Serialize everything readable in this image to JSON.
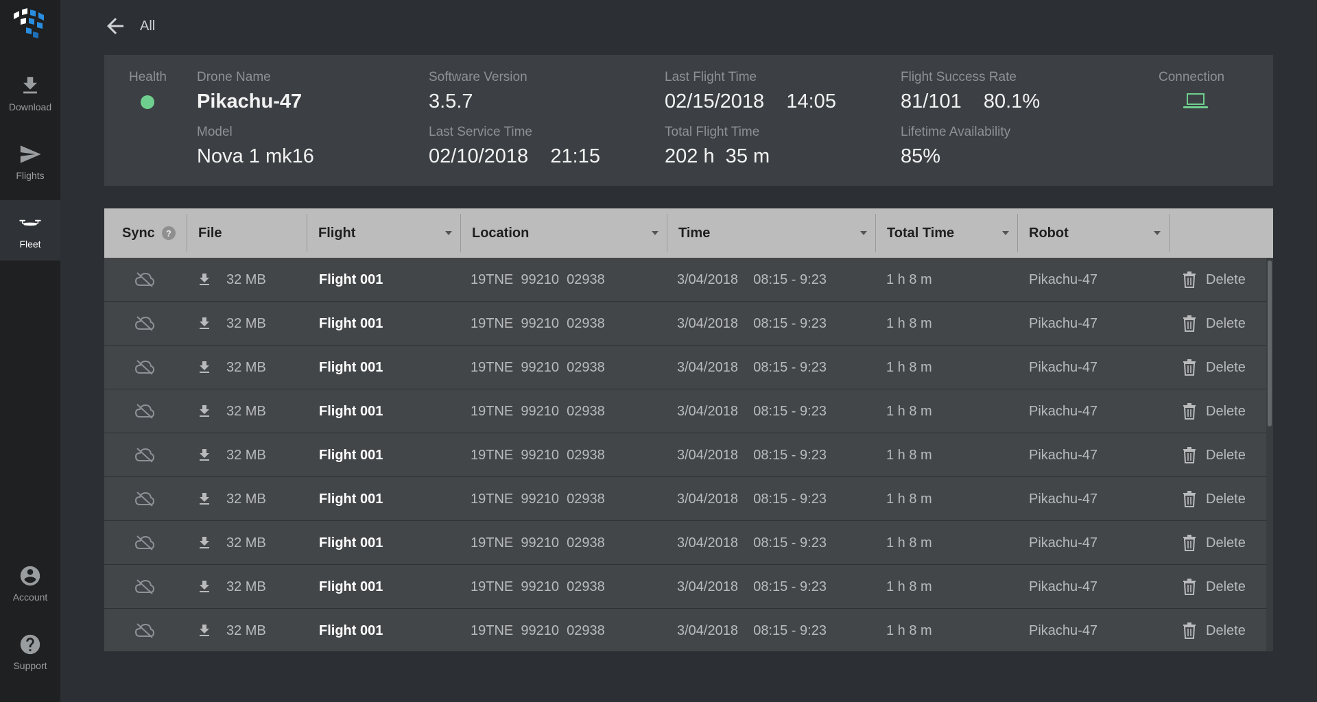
{
  "sidebar": {
    "items": [
      {
        "label": "Download",
        "icon": "download-icon"
      },
      {
        "label": "Flights",
        "icon": "send-icon"
      },
      {
        "label": "Fleet",
        "icon": "drone-icon"
      },
      {
        "label": "Account",
        "icon": "account-icon"
      },
      {
        "label": "Support",
        "icon": "help-icon"
      }
    ],
    "active": "Fleet"
  },
  "topbar": {
    "back_label": "All"
  },
  "summary": {
    "health_label": "Health",
    "drone_name_label": "Drone Name",
    "drone_name": "Pikachu-47",
    "model_label": "Model",
    "model": "Nova 1 mk16",
    "software_label": "Software Version",
    "software_version": "3.5.7",
    "last_service_label": "Last Service Time",
    "last_service": "02/10/2018    21:15",
    "last_flight_label": "Last Flight Time",
    "last_flight": "02/15/2018    14:05",
    "total_flight_label": "Total Flight Time",
    "total_flight": "202 h  35 m",
    "success_label": "Flight Success Rate",
    "success_rate": "81/101    80.1%",
    "availability_label": "Lifetime Availability",
    "availability": "85%",
    "connection_label": "Connection",
    "health_color": "#6fcf8e"
  },
  "table": {
    "headers": {
      "sync": "Sync",
      "help": "?",
      "file": "File",
      "flight": "Flight",
      "location": "Location",
      "time": "Time",
      "total_time": "Total Time",
      "robot": "Robot"
    },
    "rows": [
      {
        "size": "32 MB",
        "flight": "Flight 001",
        "location": "19TNE  99210  02938",
        "time": "3/04/2018    08:15 - 9:23",
        "total": "1 h 8 m",
        "robot": "Pikachu-47",
        "action": "Delete"
      },
      {
        "size": "32 MB",
        "flight": "Flight 001",
        "location": "19TNE  99210  02938",
        "time": "3/04/2018    08:15 - 9:23",
        "total": "1 h 8 m",
        "robot": "Pikachu-47",
        "action": "Delete"
      },
      {
        "size": "32 MB",
        "flight": "Flight 001",
        "location": "19TNE  99210  02938",
        "time": "3/04/2018    08:15 - 9:23",
        "total": "1 h 8 m",
        "robot": "Pikachu-47",
        "action": "Delete"
      },
      {
        "size": "32 MB",
        "flight": "Flight 001",
        "location": "19TNE  99210  02938",
        "time": "3/04/2018    08:15 - 9:23",
        "total": "1 h 8 m",
        "robot": "Pikachu-47",
        "action": "Delete"
      },
      {
        "size": "32 MB",
        "flight": "Flight 001",
        "location": "19TNE  99210  02938",
        "time": "3/04/2018    08:15 - 9:23",
        "total": "1 h 8 m",
        "robot": "Pikachu-47",
        "action": "Delete"
      },
      {
        "size": "32 MB",
        "flight": "Flight 001",
        "location": "19TNE  99210  02938",
        "time": "3/04/2018    08:15 - 9:23",
        "total": "1 h 8 m",
        "robot": "Pikachu-47",
        "action": "Delete"
      },
      {
        "size": "32 MB",
        "flight": "Flight 001",
        "location": "19TNE  99210  02938",
        "time": "3/04/2018    08:15 - 9:23",
        "total": "1 h 8 m",
        "robot": "Pikachu-47",
        "action": "Delete"
      },
      {
        "size": "32 MB",
        "flight": "Flight 001",
        "location": "19TNE  99210  02938",
        "time": "3/04/2018    08:15 - 9:23",
        "total": "1 h 8 m",
        "robot": "Pikachu-47",
        "action": "Delete"
      },
      {
        "size": "32 MB",
        "flight": "Flight 001",
        "location": "19TNE  99210  02938",
        "time": "3/04/2018    08:15 - 9:23",
        "total": "1 h 8 m",
        "robot": "Pikachu-47",
        "action": "Delete"
      }
    ]
  }
}
